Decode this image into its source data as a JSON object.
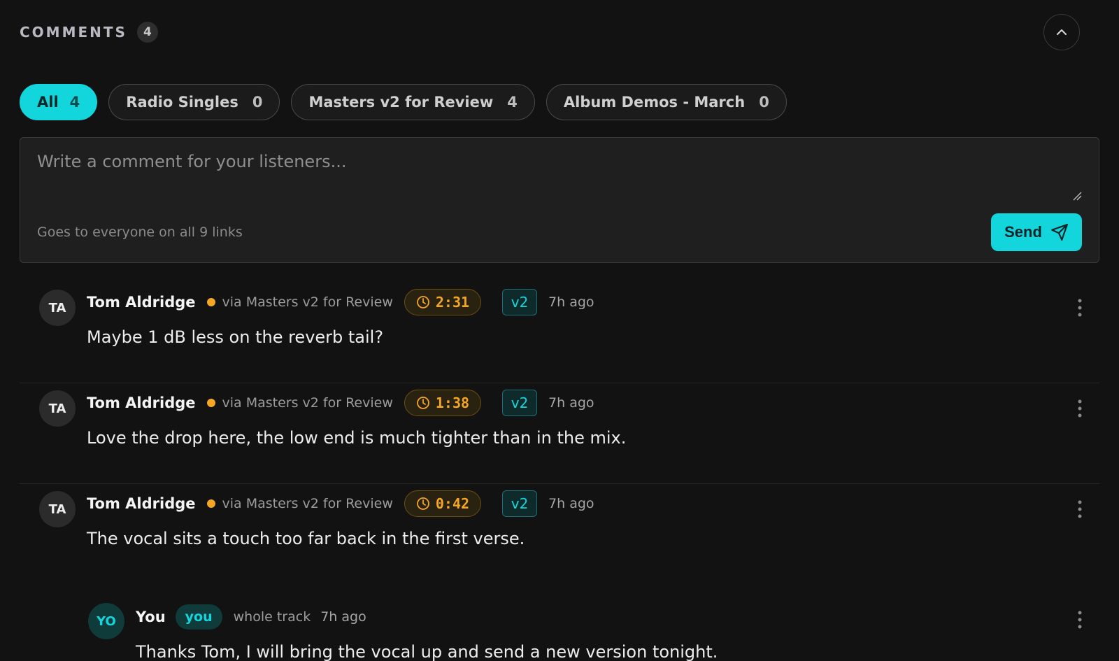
{
  "header": {
    "title": "COMMENTS",
    "count": "4"
  },
  "tabs": [
    {
      "label": "All",
      "count": "4"
    },
    {
      "label": "Radio Singles",
      "count": "0"
    },
    {
      "label": "Masters v2 for Review",
      "count": "4"
    },
    {
      "label": "Album Demos - March",
      "count": "0"
    }
  ],
  "composer": {
    "placeholder": "Write a comment for your listeners...",
    "hint": "Goes to everyone on all 9 links",
    "send_label": "Send"
  },
  "comments": [
    {
      "initials": "TA",
      "author": "Tom Aldridge",
      "via": "via Masters v2 for Review",
      "timestamp": "2:31",
      "version": "v2",
      "ago": "7h ago",
      "text": "Maybe 1 dB less on the reverb tail?"
    },
    {
      "initials": "TA",
      "author": "Tom Aldridge",
      "via": "via Masters v2 for Review",
      "timestamp": "1:38",
      "version": "v2",
      "ago": "7h ago",
      "text": "Love the drop here, the low end is much tighter than in the mix."
    },
    {
      "initials": "TA",
      "author": "Tom Aldridge",
      "via": "via Masters v2 for Review",
      "timestamp": "0:42",
      "version": "v2",
      "ago": "7h ago",
      "text": "The vocal sits a touch too far back in the first verse.",
      "reply": {
        "initials": "YO",
        "author": "You",
        "badge": "you",
        "scope": "whole track",
        "ago": "7h ago",
        "text": "Thanks Tom, I will bring the vocal up and send a new version tonight."
      }
    }
  ],
  "colors": {
    "accent": "#13d6dd",
    "timestamp": "#f5a623",
    "background": "#121212"
  },
  "icons": {
    "collapse": "chevron-up-icon",
    "send": "send-icon",
    "timestamp": "clock-icon",
    "more": "more-vertical-icon",
    "resize": "resize-handle-icon",
    "status": "status-dot"
  }
}
